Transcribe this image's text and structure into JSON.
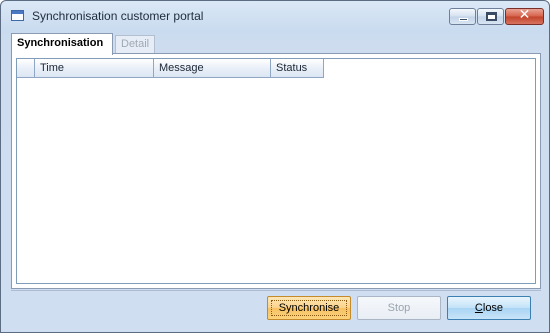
{
  "window": {
    "title": "Synchronisation customer portal"
  },
  "title_buttons": {
    "minimize_icon": "minimize-icon",
    "maximize_icon": "maximize-icon",
    "close_glyph": "✕"
  },
  "tabs": [
    {
      "label": "Synchronisation",
      "active": true,
      "enabled": true
    },
    {
      "label": "Detail",
      "active": false,
      "enabled": false
    }
  ],
  "grid": {
    "columns": [
      "Time",
      "Message",
      "Status"
    ],
    "rows": []
  },
  "buttons": {
    "synchronise": "Synchronise",
    "stop": "Stop",
    "close": "Close"
  },
  "colors": {
    "highlight_button": "#f7c164",
    "default_button": "#a9d4f3",
    "disabled_text": "#9aa3ae"
  }
}
